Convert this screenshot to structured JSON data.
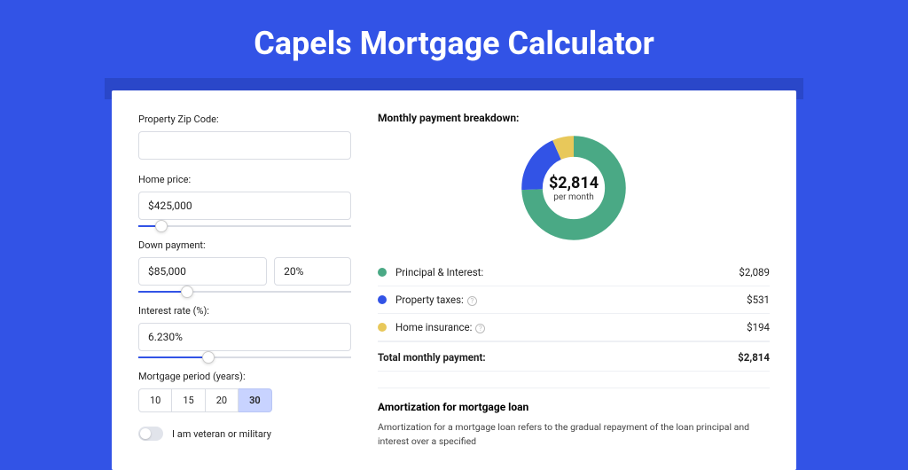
{
  "page": {
    "title": "Capels Mortgage Calculator"
  },
  "form": {
    "zip_label": "Property Zip Code:",
    "zip_value": "",
    "home_price_label": "Home price:",
    "home_price_value": "$425,000",
    "home_price_slider_pct": 8,
    "down_payment_label": "Down payment:",
    "down_payment_value": "$85,000",
    "down_payment_pct_value": "20%",
    "down_payment_slider_pct": 20,
    "interest_label": "Interest rate (%):",
    "interest_value": "6.230%",
    "interest_slider_pct": 30,
    "period_label": "Mortgage period (years):",
    "periods": [
      "10",
      "15",
      "20",
      "30"
    ],
    "period_active_index": 3,
    "veteran_label": "I am veteran or military"
  },
  "breakdown": {
    "title": "Monthly payment breakdown:",
    "center_value": "$2,814",
    "center_sub": "per month",
    "items": [
      {
        "label": "Principal & Interest:",
        "value": "$2,089",
        "color": "#4aa985",
        "info": false
      },
      {
        "label": "Property taxes:",
        "value": "$531",
        "color": "#3253e6",
        "info": true
      },
      {
        "label": "Home insurance:",
        "value": "$194",
        "color": "#e8c85a",
        "info": true
      }
    ],
    "total_label": "Total monthly payment:",
    "total_value": "$2,814"
  },
  "amortization": {
    "title": "Amortization for mortgage loan",
    "text": "Amortization for a mortgage loan refers to the gradual repayment of the loan principal and interest over a specified"
  },
  "chart_data": {
    "type": "pie",
    "title": "Monthly payment breakdown",
    "categories": [
      "Principal & Interest",
      "Property taxes",
      "Home insurance"
    ],
    "values": [
      2089,
      531,
      194
    ],
    "colors": [
      "#4aa985",
      "#3253e6",
      "#e8c85a"
    ],
    "total": 2814,
    "center_label": "$2,814 per month"
  }
}
